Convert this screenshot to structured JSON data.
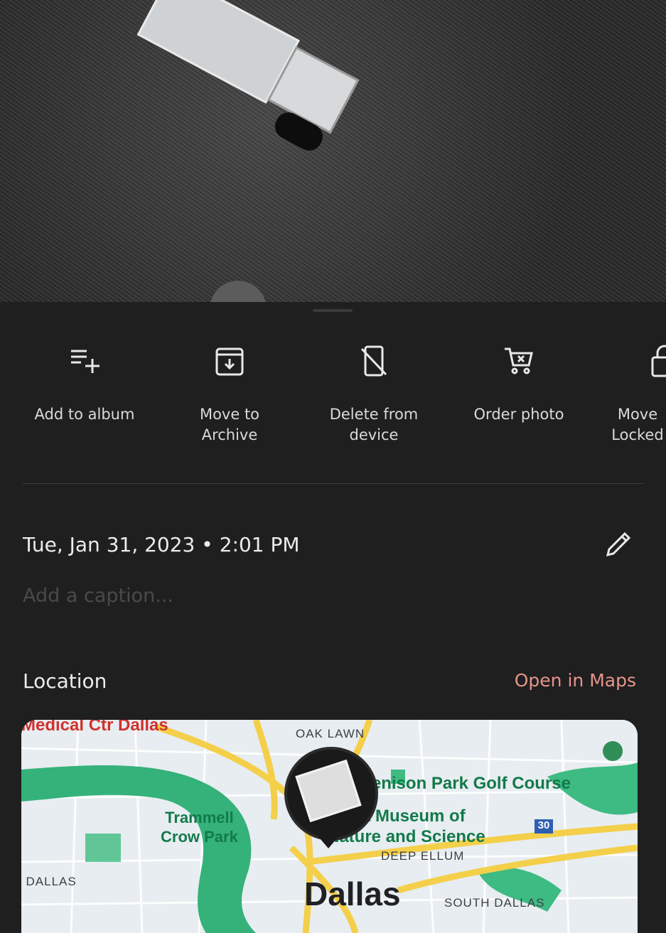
{
  "actions": [
    {
      "label": "Add to album",
      "icon": "playlist-add-icon"
    },
    {
      "label": "Move to\nArchive",
      "icon": "archive-icon"
    },
    {
      "label": "Delete from\ndevice",
      "icon": "device-delete-icon"
    },
    {
      "label": "Order photo",
      "icon": "cart-icon"
    },
    {
      "label": "Move\nLocked",
      "icon": "lock-icon"
    }
  ],
  "details": {
    "datetime": "Tue, Jan 31, 2023  •  2:01 PM",
    "caption_placeholder": "Add a caption..."
  },
  "location": {
    "heading": "Location",
    "open_maps": "Open in Maps"
  },
  "map": {
    "labels": {
      "medical": "Medical Ctr Dallas",
      "oak_lawn": "OAK LAWN",
      "golf": "Tenison Park Golf Course",
      "trammell": "Trammell\nCrow Park",
      "museum": "Perot Museum of\nNature and Science",
      "deep_ellum": "DEEP ELLUM",
      "west_dallas": "WEST DALLAS",
      "dallas": "Dallas",
      "south_dallas": "SOUTH DALLAS",
      "highway": "30"
    }
  },
  "colors": {
    "accent": "#e6948a",
    "sheet": "#1f1f1f",
    "park_green": "#34b27a",
    "highway_yellow": "#f4cf4a"
  }
}
